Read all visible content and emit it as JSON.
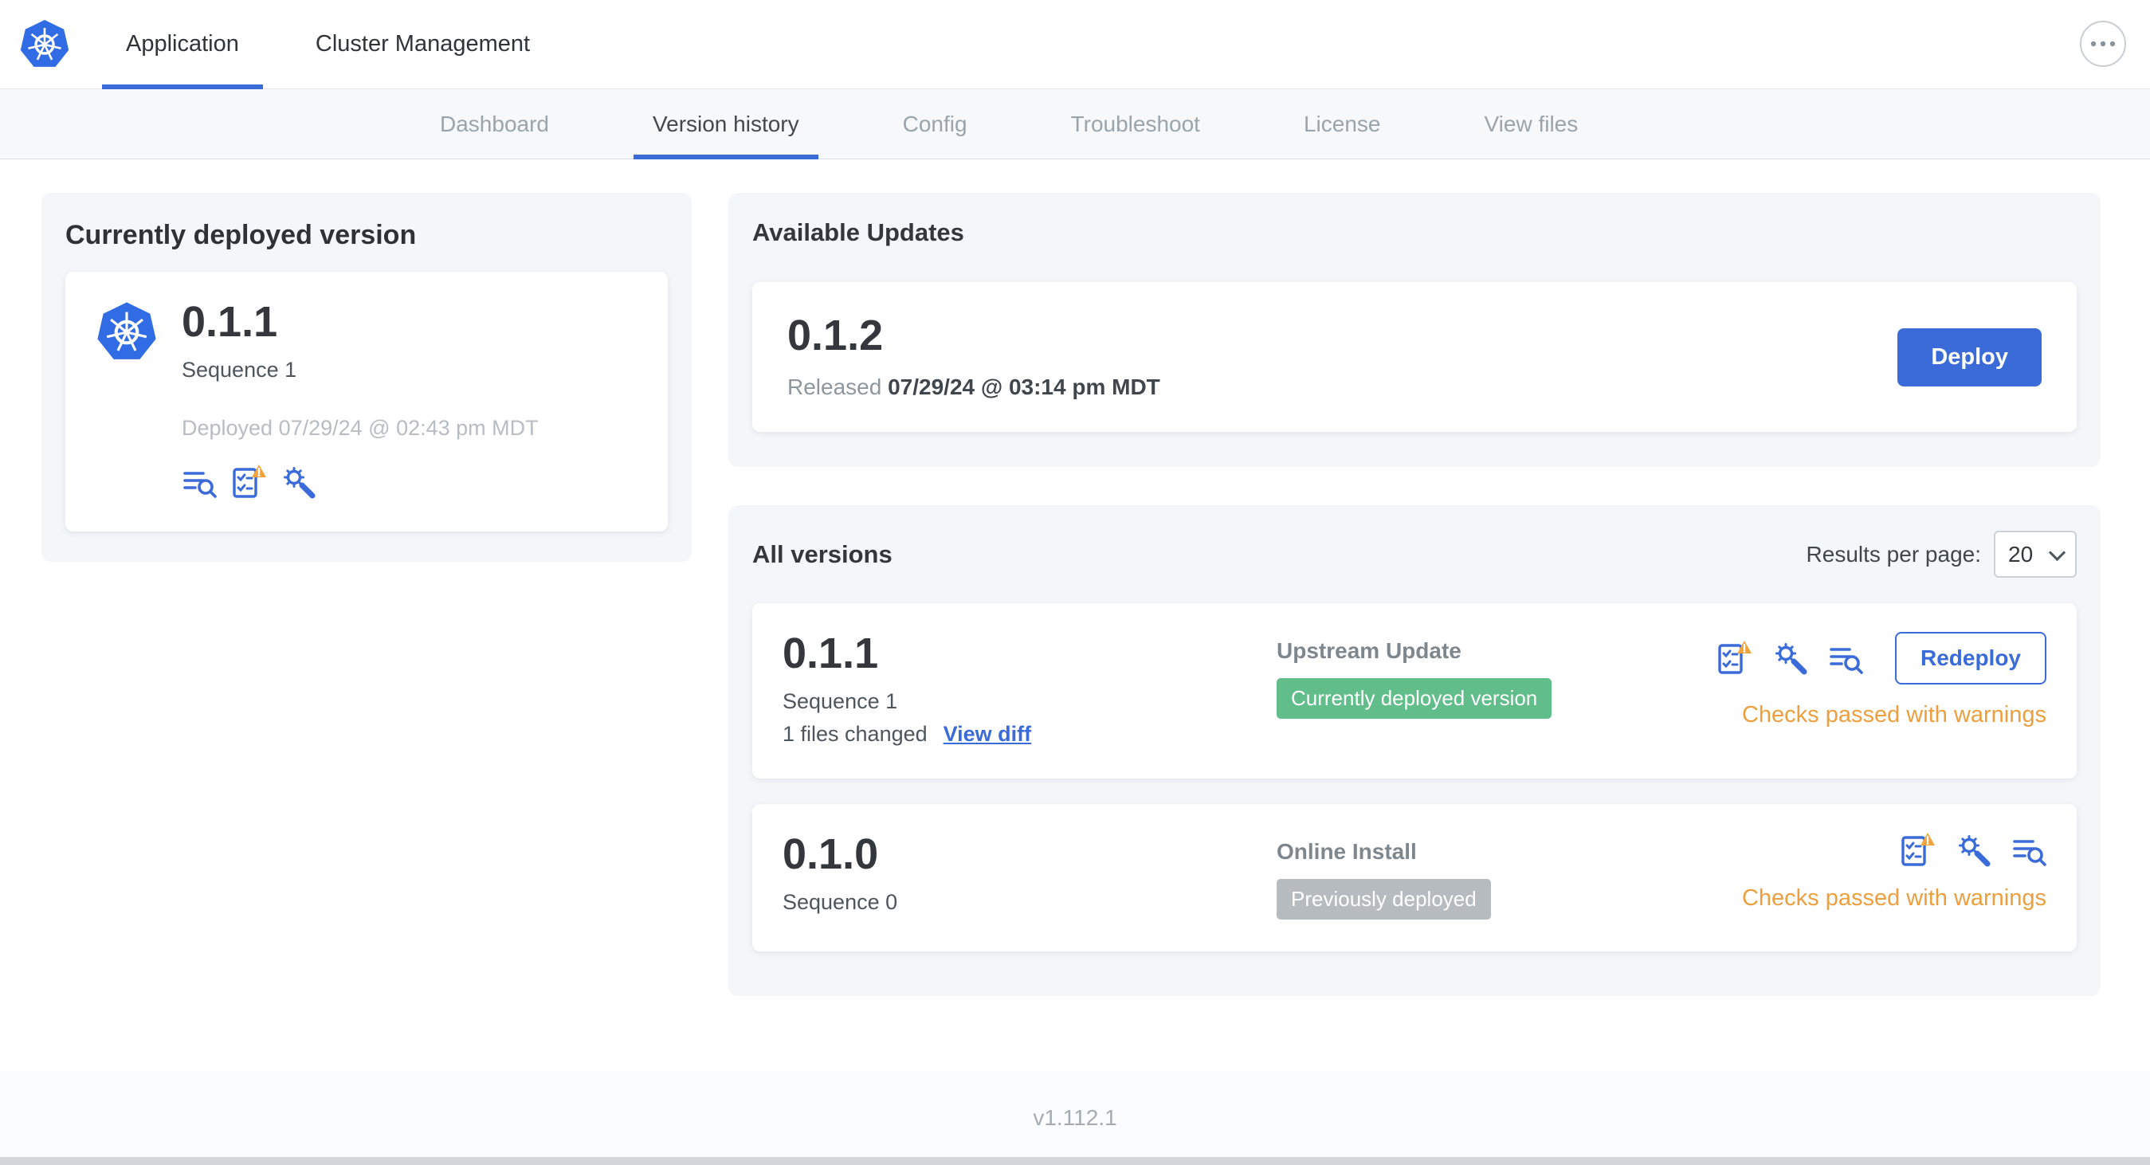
{
  "colors": {
    "accent": "#3A6BD8",
    "k8s_blue": "#326CE5",
    "warning_text": "#EC9F3F",
    "warning_triangle": "#F2A33C",
    "success_badge": "#61BD8A",
    "neutral_badge": "#B6BBBF",
    "subnav_bg": "#F6F8F9",
    "card_bg": "#F4F7FA"
  },
  "icons": {
    "app_logo": "kubernetes-logo",
    "overflow": "ellipsis-icon",
    "preflight": "preflight-checks-icon",
    "config": "edit-config-icon",
    "logs": "deploy-logs-icon",
    "warning": "warning-triangle-icon",
    "select_chevron": "chevron-down-icon"
  },
  "header": {
    "tabs": [
      {
        "label": "Application",
        "active": true
      },
      {
        "label": "Cluster Management",
        "active": false
      }
    ]
  },
  "subnav": {
    "items": [
      "Dashboard",
      "Version history",
      "Config",
      "Troubleshoot",
      "License",
      "View files"
    ],
    "active": "Version history"
  },
  "deployed_card": {
    "title": "Currently deployed version",
    "version": "0.1.1",
    "sequence": "Sequence 1",
    "deployed_at": "Deployed 07/29/24 @ 02:43 pm MDT"
  },
  "available_updates": {
    "title": "Available Updates",
    "version": "0.1.2",
    "released_label": "Released",
    "released_date": "07/29/24 @ 03:14 pm MDT",
    "deploy_button": "Deploy"
  },
  "all_versions": {
    "title": "All versions",
    "results_per_page_label": "Results per page:",
    "results_per_page_value": "20",
    "rows": [
      {
        "version": "0.1.1",
        "sequence": "Sequence 1",
        "files_changed": "1 files changed",
        "view_diff_link": "View diff",
        "source": "Upstream Update",
        "status_badge": "Currently deployed version",
        "action_button": "Redeploy",
        "checks_status": "Checks passed with warnings"
      },
      {
        "version": "0.1.0",
        "sequence": "Sequence 0",
        "source": "Online Install",
        "status_badge": "Previously deployed",
        "checks_status": "Checks passed with warnings"
      }
    ]
  },
  "footer": {
    "app_version": "v1.112.1"
  }
}
